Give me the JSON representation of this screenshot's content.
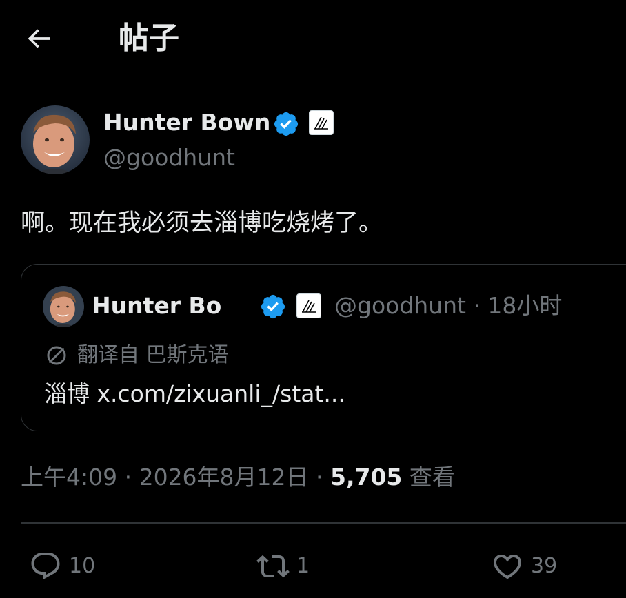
{
  "header": {
    "title": "帖子"
  },
  "author": {
    "name": "Hunter Bown",
    "handle": "@goodhunt"
  },
  "post": {
    "text": "啊。现在我必须去淄博吃烧烤了。"
  },
  "quote": {
    "name": "Hunter Bo",
    "meta": "@goodhunt · 18小时",
    "translation_label": "翻译自 巴斯克语",
    "text": "淄博 x.com/zixuanli_/stat..."
  },
  "timestamp": {
    "time_date": "上午4:09 · 2026年8月12日 · ",
    "views_count": "5,705",
    "views_label": " 查看"
  },
  "actions": {
    "reply_count": "10",
    "repost_count": "1",
    "like_count": "39"
  },
  "colors": {
    "background": "#000000",
    "primary_text": "#e7e9ea",
    "secondary_text": "#71767b",
    "verified_blue": "#1d9bf0",
    "border": "#2f3336"
  }
}
